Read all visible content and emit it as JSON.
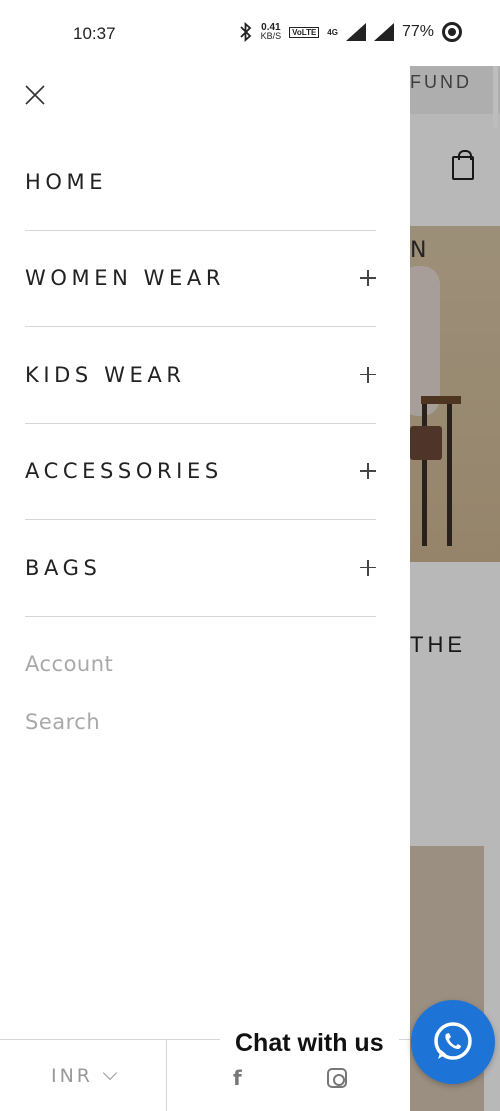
{
  "status_bar": {
    "time": "10:37",
    "net_speed_value": "0.41",
    "net_speed_unit": "KB/S",
    "volte": "VoLTE",
    "network": "4G",
    "battery": "77%",
    "icons": [
      "bluetooth-icon",
      "signal-icon",
      "signal-icon",
      "data-saver-icon"
    ]
  },
  "background_page": {
    "banner_text": "FUND",
    "hero_letter": "N",
    "section_text": "THE"
  },
  "drawer": {
    "close_icon": "close-icon",
    "menu": [
      {
        "label": "HOME",
        "expandable": false
      },
      {
        "label": "WOMEN WEAR",
        "expandable": true
      },
      {
        "label": "KIDS WEAR",
        "expandable": true
      },
      {
        "label": "ACCESSORIES",
        "expandable": true
      },
      {
        "label": "BAGS",
        "expandable": true
      }
    ],
    "secondary_links": [
      "Account",
      "Search"
    ],
    "footer": {
      "currency": "INR",
      "social_icons": [
        "facebook-icon",
        "instagram-icon"
      ]
    }
  },
  "chat": {
    "label": "Chat with us",
    "icon": "whatsapp-icon",
    "color": "#1e73d6"
  }
}
